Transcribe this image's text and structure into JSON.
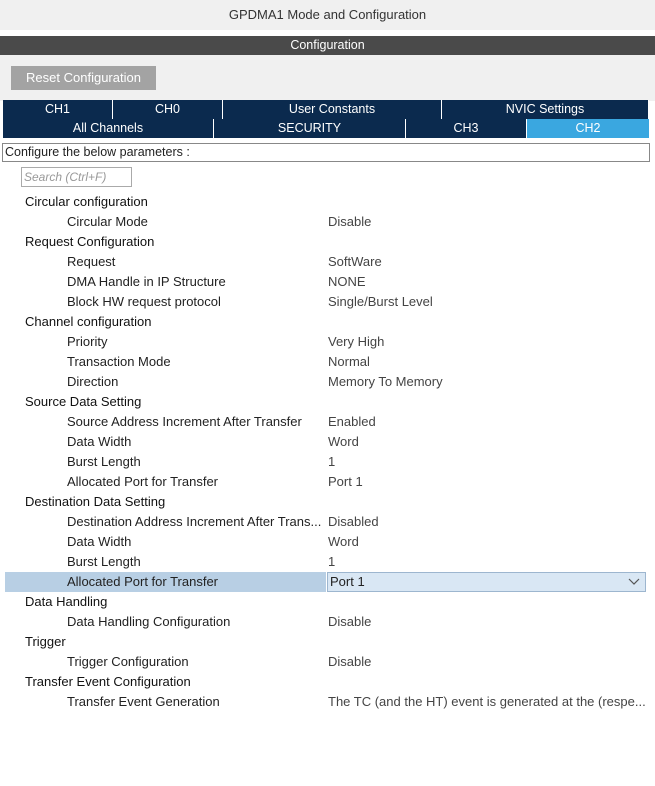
{
  "window": {
    "title": "GPDMA1 Mode and Configuration"
  },
  "config_bar": {
    "label": "Configuration"
  },
  "reset_button": {
    "label": "Reset Configuration"
  },
  "tabs_row1": [
    {
      "label": "CH1"
    },
    {
      "label": "CH0"
    },
    {
      "label": "User Constants"
    },
    {
      "label": "NVIC Settings"
    }
  ],
  "tabs_row2": [
    {
      "label": "All Channels"
    },
    {
      "label": "SECURITY"
    },
    {
      "label": "CH3"
    },
    {
      "label": "CH2",
      "active": true
    }
  ],
  "configure_label": "Configure the below parameters :",
  "search": {
    "placeholder": "Search (Ctrl+F)"
  },
  "params": [
    {
      "group": "Circular configuration"
    },
    {
      "label": "Circular Mode",
      "value": "Disable"
    },
    {
      "group": "Request Configuration"
    },
    {
      "label": "Request",
      "value": "SoftWare"
    },
    {
      "label": "DMA Handle in IP Structure",
      "value": "NONE"
    },
    {
      "label": "Block HW request protocol",
      "value": "Single/Burst Level"
    },
    {
      "group": "Channel configuration"
    },
    {
      "label": "Priority",
      "value": "Very High"
    },
    {
      "label": "Transaction Mode",
      "value": "Normal"
    },
    {
      "label": "Direction",
      "value": "Memory To Memory"
    },
    {
      "group": "Source Data Setting"
    },
    {
      "label": "Source Address Increment After Transfer",
      "value": "Enabled"
    },
    {
      "label": "Data Width",
      "value": "Word"
    },
    {
      "label": "Burst Length",
      "value": "1"
    },
    {
      "label": "Allocated Port for Transfer",
      "value": "Port 1"
    },
    {
      "group": "Destination Data Setting"
    },
    {
      "label": "Destination Address Increment After Trans...",
      "value": "Disabled"
    },
    {
      "label": "Data Width",
      "value": "Word"
    },
    {
      "label": "Burst Length",
      "value": "1"
    },
    {
      "label": "Allocated Port for Transfer",
      "value": "Port 1",
      "selected": true
    },
    {
      "group": "Data Handling"
    },
    {
      "label": "Data Handling Configuration",
      "value": "Disable"
    },
    {
      "group": "Trigger"
    },
    {
      "label": "Trigger Configuration",
      "value": "Disable"
    },
    {
      "group": "Transfer Event Configuration"
    },
    {
      "label": "Transfer Event Generation",
      "value": "The TC (and the HT) event is generated at the (respe..."
    }
  ]
}
